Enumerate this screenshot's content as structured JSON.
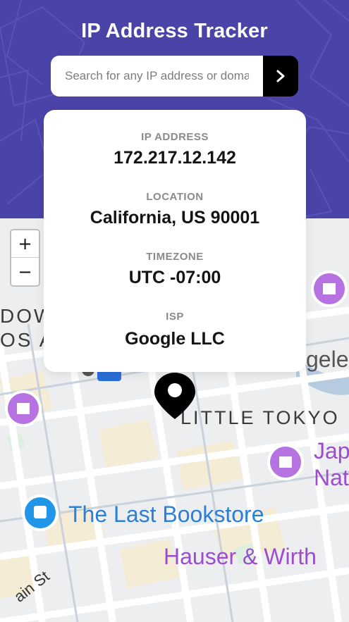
{
  "header": {
    "title": "IP Address Tracker",
    "bg_color": "#4a44a8"
  },
  "search": {
    "placeholder": "Search for any IP address or domain",
    "button_icon": "chevron-right-icon"
  },
  "info": {
    "ip_label": "IP ADDRESS",
    "ip_value": "172.217.12.142",
    "location_label": "LOCATION",
    "location_value": "California, US 90001",
    "timezone_label": "TIMEZONE",
    "timezone_value": "UTC -07:00",
    "isp_label": "ISP",
    "isp_value": "Google LLC"
  },
  "map": {
    "zoom_in": "+",
    "zoom_out": "−",
    "labels": {
      "dow": "DOW",
      "os_a": "OS A",
      "little_tokyo": "LITTLE TOKYO",
      "geles": "geles",
      "jap": "Jap",
      "nat": "Nat",
      "bookstore": "The Last Bookstore",
      "hauser": "Hauser & Wirth",
      "main_st": "ain St"
    }
  }
}
